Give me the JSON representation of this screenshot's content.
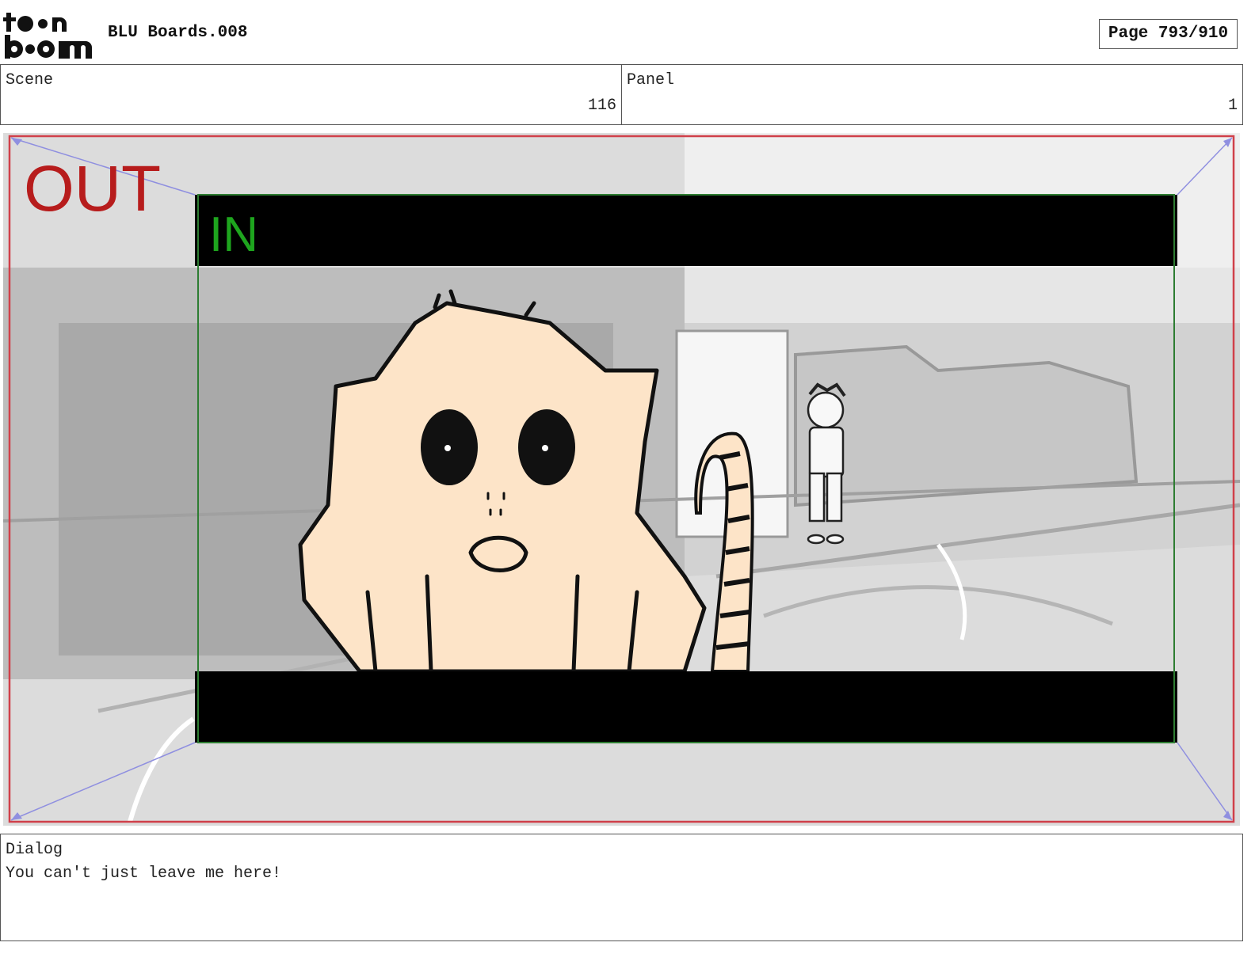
{
  "header": {
    "logo_text": "toon boom",
    "title": "BLU Boards.008",
    "page_label": "Page 793/910"
  },
  "info": {
    "scene_label": "Scene",
    "scene_value": "116",
    "panel_label": "Panel",
    "panel_value": "1"
  },
  "frame": {
    "out_label": "OUT",
    "in_label": "IN",
    "colors": {
      "out_border": "#d0404a",
      "in_border": "#2e7d32",
      "guides": "#8f8fe0",
      "letterbox": "#000000"
    }
  },
  "dialog": {
    "label": "Dialog",
    "text": "You can't just leave me here!"
  }
}
